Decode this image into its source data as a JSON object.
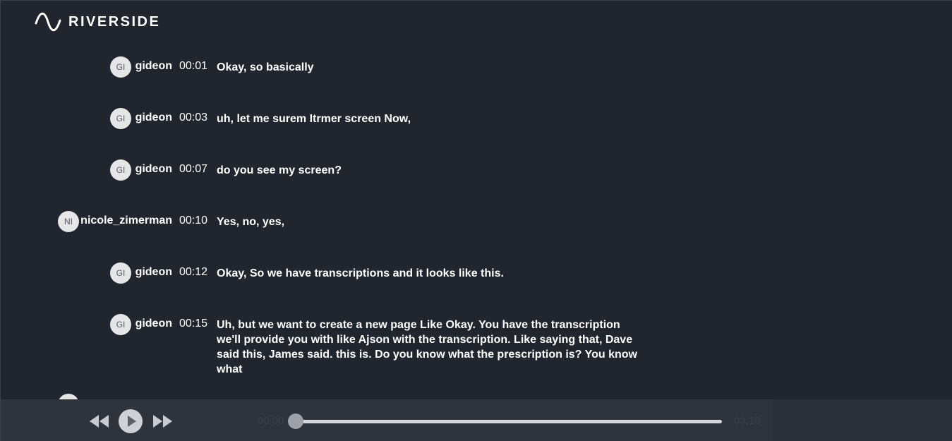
{
  "app": {
    "brand": "RIVERSIDE"
  },
  "transcript": [
    {
      "initials": "GI",
      "speaker": "gideon",
      "time": "00:01",
      "text": "Okay, so basically"
    },
    {
      "initials": "GI",
      "speaker": "gideon",
      "time": "00:03",
      "text": "uh, let me surem Itrmer screen Now,"
    },
    {
      "initials": "GI",
      "speaker": "gideon",
      "time": "00:07",
      "text": "do you see my screen?"
    },
    {
      "initials": "NI",
      "speaker": "nicole_zimerman",
      "time": "00:10",
      "text": "Yes, no, yes,"
    },
    {
      "initials": "GI",
      "speaker": "gideon",
      "time": "00:12",
      "text": "Okay, So we have transcriptions and it looks like this."
    },
    {
      "initials": "GI",
      "speaker": "gideon",
      "time": "00:15",
      "text": "Uh, but we want to create a new page Like Okay. You have the transcription we'll provide you with like Ajson with the transcription. Like saying that, Dave said this, James said. this is. Do you know what the prescription is? You know what"
    }
  ],
  "player": {
    "current_time": "00:00",
    "total_time": "03:10",
    "progress": 0.0,
    "icons": {
      "rewind": "rewind-icon",
      "play": "play-icon",
      "forward": "fast-forward-icon"
    }
  },
  "colors": {
    "background": "#21252d",
    "player_bar": "#2f343c",
    "avatar": "#e6e6e8",
    "text": "#ffffff"
  }
}
